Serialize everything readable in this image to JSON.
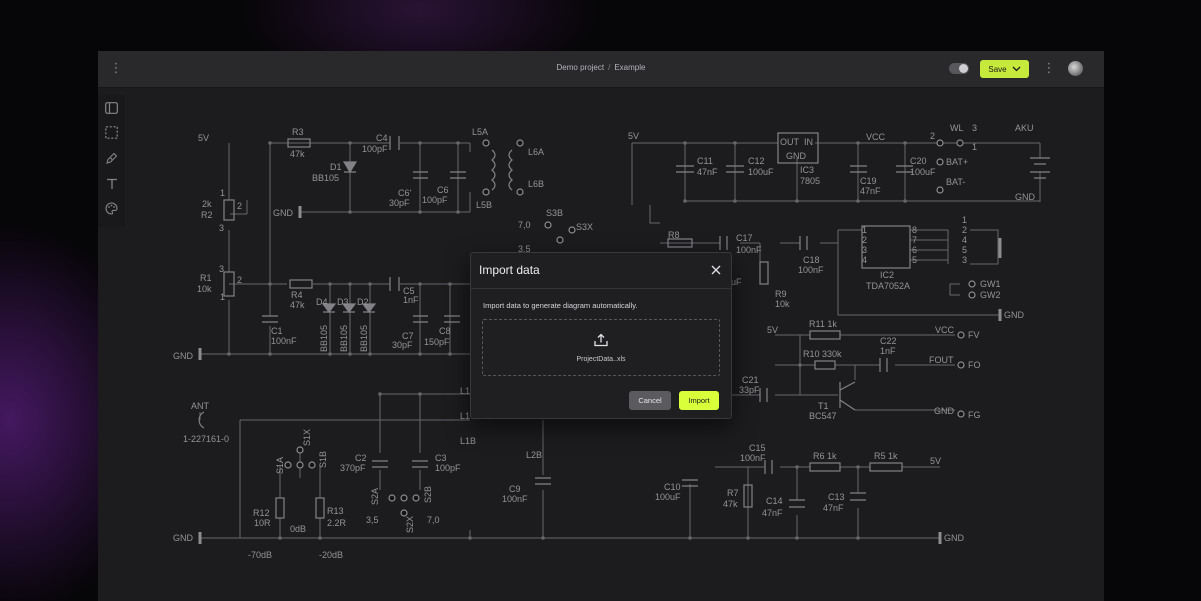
{
  "header": {
    "project": "Demo project",
    "separator": "/",
    "page": "Example",
    "save_label": "Save",
    "accent_color": "#c6ea3c"
  },
  "toolbar": {
    "tools": [
      "panel-icon",
      "select-icon",
      "pen-icon",
      "text-icon",
      "palette-icon"
    ]
  },
  "schematic": {
    "labels": {
      "v5_left": "5V",
      "r3": "R3",
      "r3_val": "47k",
      "c4": "C4",
      "c4_val": "100pF",
      "d1": "D1",
      "d1_val": "BB105",
      "c6p": "C6'",
      "c6p_val": "30pF",
      "c6": "C6",
      "c6_val": "100pF",
      "l5a": "L5A",
      "l5b": "L5B",
      "l6a": "L6A",
      "l6b": "L6B",
      "gnd_r2": "GND",
      "r2_pot": "2k",
      "r2": "R2",
      "r1_pot": "10k",
      "r1": "R1",
      "pin2a": "2",
      "pin3a": "3",
      "pin1a": "1",
      "pin2b": "2",
      "pin3b": "3",
      "pin1b": "1",
      "r4": "R4",
      "r4_val": "47k",
      "c1": "C1",
      "c1_val": "100nF",
      "d4": "D4",
      "d3": "D3",
      "d2": "D2",
      "bb1": "BB105",
      "bb2": "BB105",
      "bb3": "BB105",
      "c5": "C5",
      "c5_val": "1nF",
      "c7": "C7",
      "c7_val": "30pF",
      "c8": "C8",
      "c8_val": "150pF",
      "gnd_left": "GND",
      "v5_mid": "5V",
      "s3b": "S3B",
      "s3x": "S3X",
      "v70": "7,0",
      "v35": "3,5",
      "r8": "R8",
      "c17": "C17",
      "c17_val": "100nF",
      "uf": "uF",
      "c11": "C11",
      "c11_val": "47nF",
      "c12": "C12",
      "c12_val": "100uF",
      "out": "OUT",
      "in": "IN",
      "gnd_ic3": "GND",
      "ic3": "IC3",
      "ic3_val": "7805",
      "vcc": "VCC",
      "c19": "C19",
      "c19_val": "47nF",
      "c20": "C20",
      "c20_val": "100uF",
      "wl": "WL",
      "wl2": "2",
      "wl3": "3",
      "wl1": "1",
      "bat_plus": "BAT+",
      "bat_minus": "BAT-",
      "aku": "AKU",
      "gnd_aku": "GND",
      "c18": "C18",
      "c18_val": "100nF",
      "r9": "R9",
      "r9_val": "10k",
      "ic2": "IC2",
      "ic2_val": "TDA7052A",
      "p1": "1",
      "p2": "2",
      "p3": "3",
      "p4": "4",
      "p5": "5",
      "p6": "6",
      "p7": "7",
      "p8": "8",
      "j1": "1",
      "j2": "2",
      "j4": "4",
      "j5": "5",
      "j3": "3",
      "gw1": "GW1",
      "gw2": "GW2",
      "gnd_ic2": "GND",
      "v5_r11": "5V",
      "r11": "R11 1k",
      "vcc_fv": "VCC",
      "fv": "FV",
      "r10": "R10 330k",
      "c22": "C22",
      "c22_val": "1nF",
      "fout": "FOUT",
      "fo": "FO",
      "c21": "C21",
      "c21_val": "33pF",
      "t1": "T1",
      "t1_val": "BC547",
      "gnd_fg": "GND",
      "fg": "FG",
      "ant": "ANT",
      "ant_val": "1-227161-0",
      "s1x": "S1X",
      "s1a": "S1A",
      "s1b": "S1B",
      "r12": "R12",
      "r12_val": "10R",
      "r13": "R13",
      "r13_val": "2.2R",
      "zero_db": "0dB",
      "gnd_bottom": "GND",
      "m70": "-70dB",
      "m20": "-20dB",
      "c2": "C2",
      "c2_val": "370pF",
      "c3": "C3",
      "c3_val": "100pF",
      "s2a": "S2A",
      "s2b": "S2B",
      "s2x": "S2X",
      "b35": "3,5",
      "b70": "7,0",
      "l1a": "L1",
      "l1b": "L1",
      "l1c": "L1B",
      "l2b": "L2B",
      "c9": "C9",
      "c9_val": "100nF",
      "c10": "C10",
      "c10_val": "100uF",
      "c15": "C15",
      "c15_val": "100nF",
      "r6": "R6 1k",
      "r5": "R5 1k",
      "v5_r5": "5V",
      "r7": "R7",
      "r7_val": "47k",
      "c14": "C14",
      "c14_val": "47nF",
      "c13": "C13",
      "c13_val": "47nF",
      "gnd_right_bottom": "GND"
    }
  },
  "modal": {
    "title": "Import data",
    "description": "Import data to generate diagram automatically.",
    "file_name": "ProjectData..xls",
    "cancel_label": "Cancel",
    "import_label": "Import"
  }
}
